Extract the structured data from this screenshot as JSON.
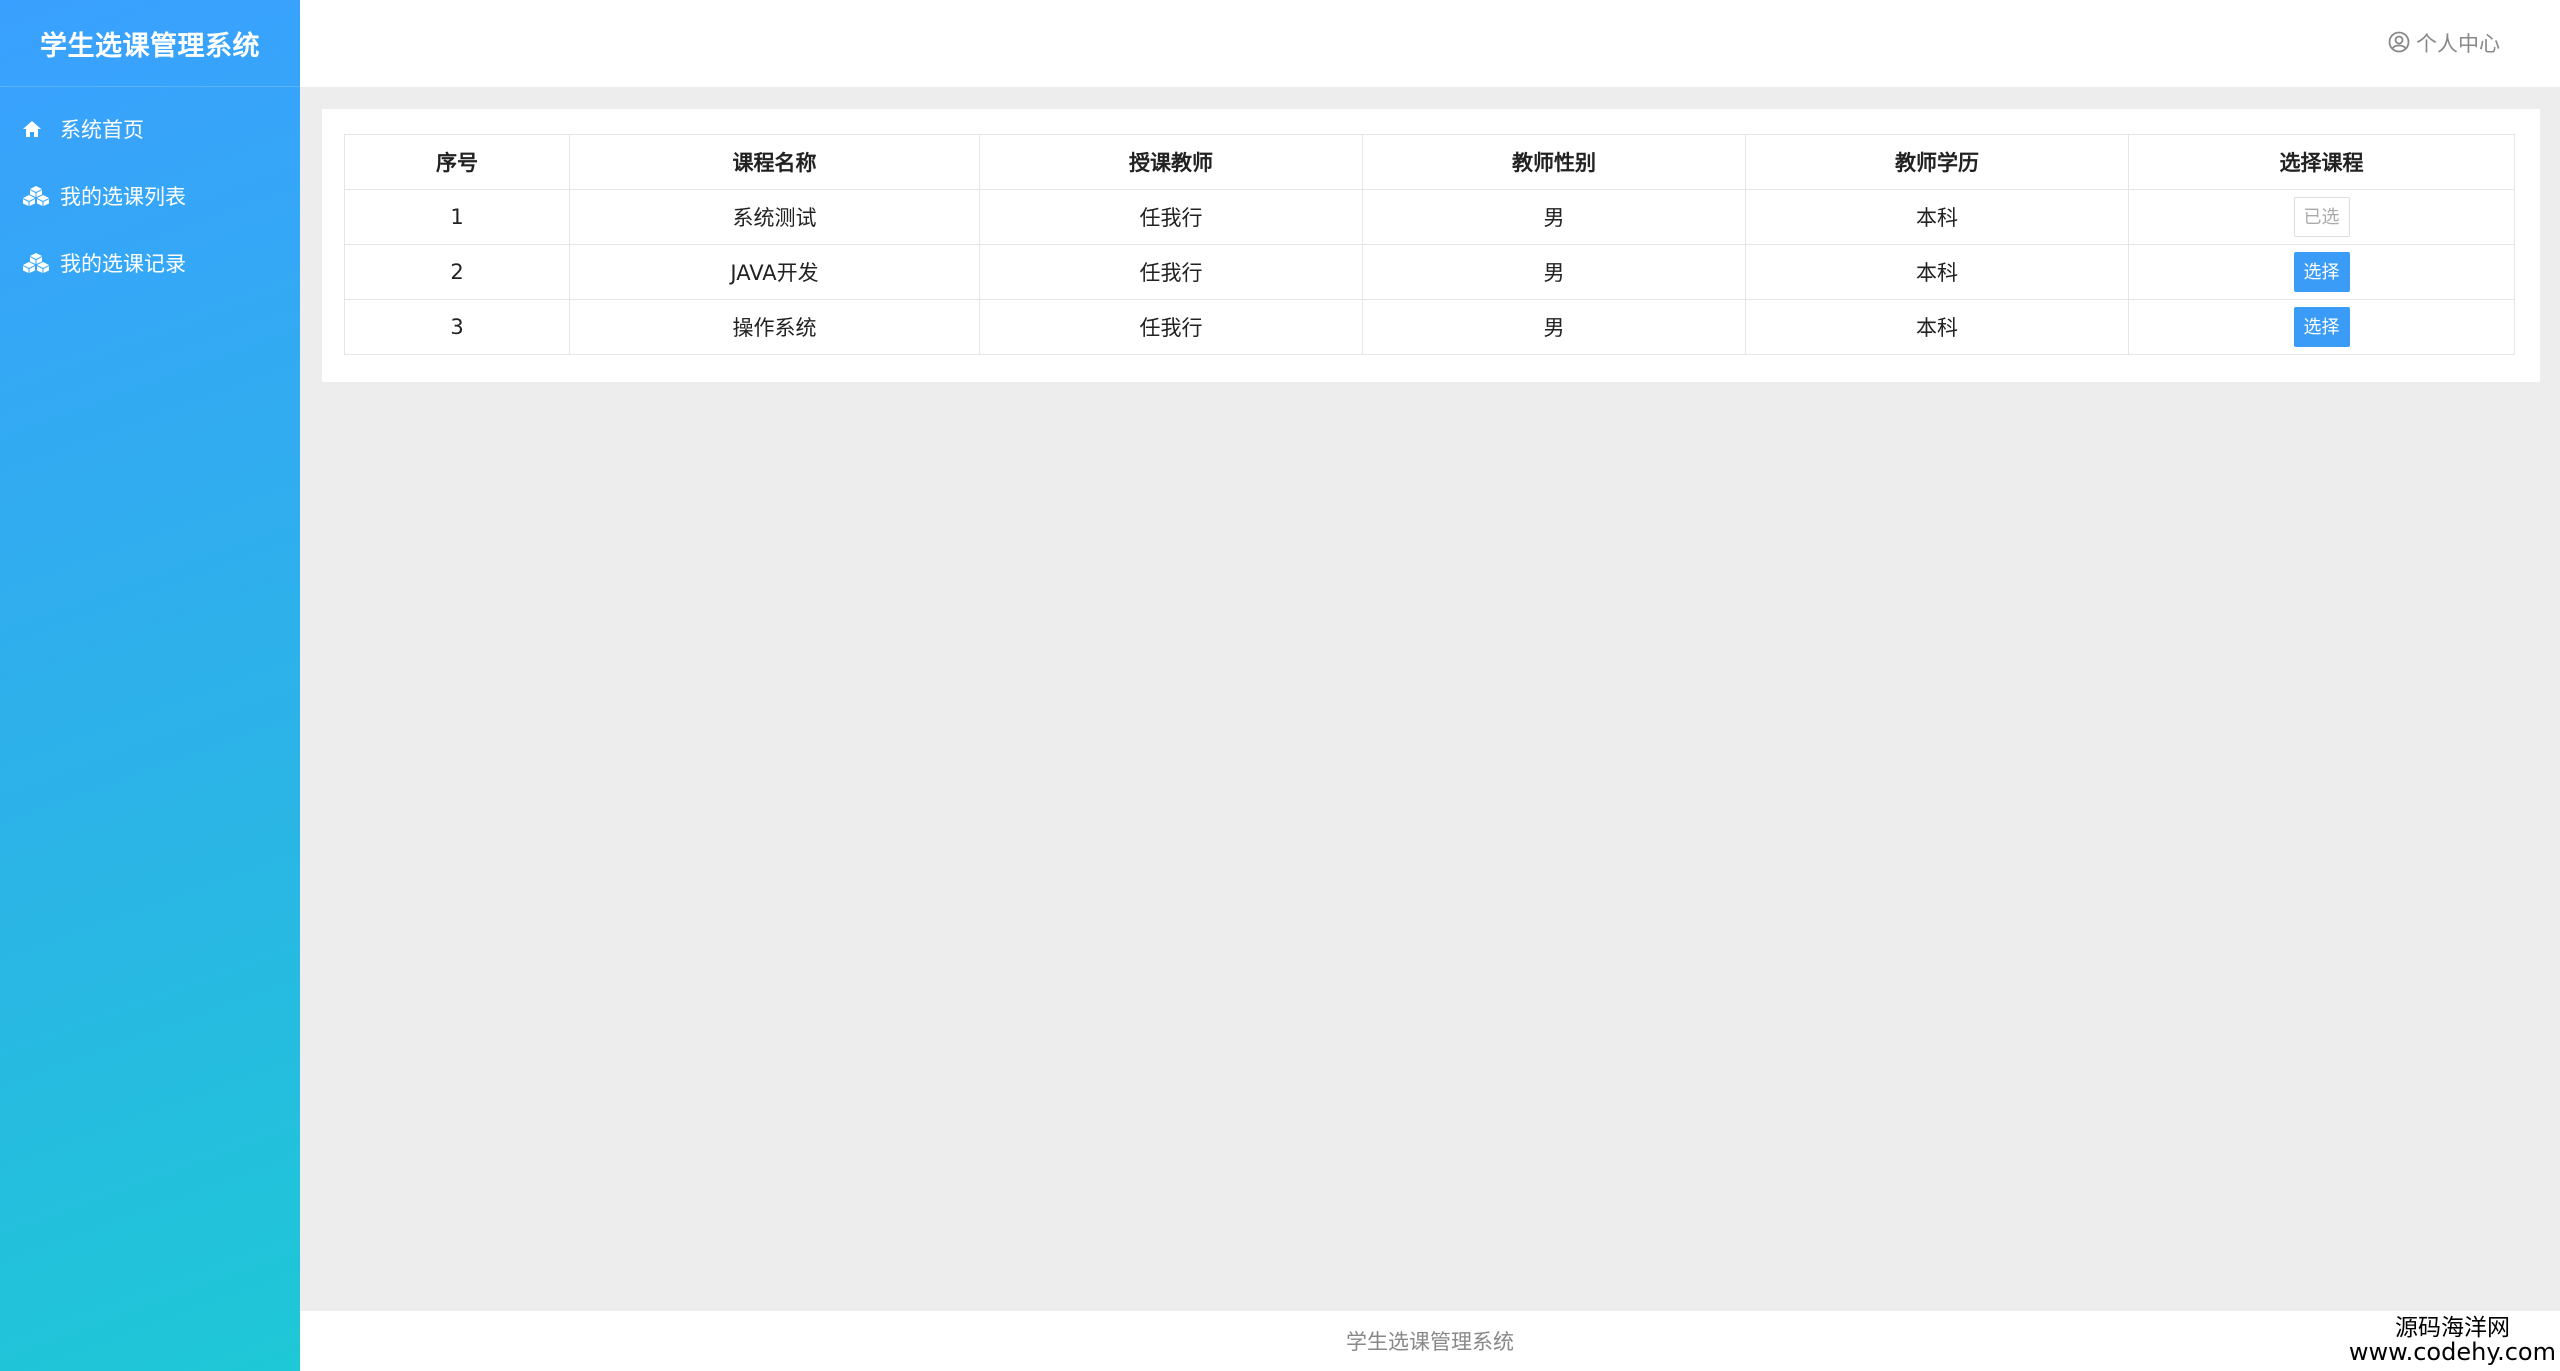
{
  "app": {
    "title": "学生选课管理系统"
  },
  "sidebar": {
    "items": [
      {
        "label": "系统首页",
        "icon": "home-icon"
      },
      {
        "label": "我的选课列表",
        "icon": "cubes-icon"
      },
      {
        "label": "我的选课记录",
        "icon": "cubes-icon"
      }
    ]
  },
  "header": {
    "user_center_label": "个人中心",
    "user_icon": "user-circle-icon"
  },
  "table": {
    "headers": [
      "序号",
      "课程名称",
      "授课教师",
      "教师性别",
      "教师学历",
      "选择课程"
    ],
    "rows": [
      {
        "index": "1",
        "course": "系统测试",
        "teacher": "任我行",
        "gender": "男",
        "education": "本科",
        "action": "已选",
        "selected": true
      },
      {
        "index": "2",
        "course": "JAVA开发",
        "teacher": "任我行",
        "gender": "男",
        "education": "本科",
        "action": "选择",
        "selected": false
      },
      {
        "index": "3",
        "course": "操作系统",
        "teacher": "任我行",
        "gender": "男",
        "education": "本科",
        "action": "选择",
        "selected": false
      }
    ]
  },
  "footer": {
    "text": "学生选课管理系统"
  },
  "watermark": {
    "line1": "源码海洋网",
    "line2": "www.codehy.com"
  },
  "colors": {
    "accent": "#3b9cf8",
    "sidebar_top": "#3aa0ff",
    "sidebar_bottom": "#1ec8d6",
    "background": "#ededed"
  }
}
